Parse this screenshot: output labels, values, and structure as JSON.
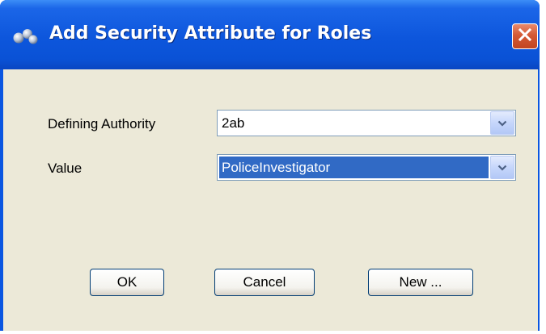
{
  "window": {
    "title": "Add Security Attribute for Roles",
    "close_icon": "close-icon"
  },
  "form": {
    "defining_authority": {
      "label": "Defining Authority",
      "value": "2ab"
    },
    "value": {
      "label": "Value",
      "value": "PoliceInvestigator"
    }
  },
  "buttons": {
    "ok": "OK",
    "cancel": "Cancel",
    "new": "New ..."
  },
  "colors": {
    "titlebar": "#0a52d6",
    "client_bg": "#ece9d8",
    "selection": "#316ac5",
    "close_button": "#d45a35"
  }
}
